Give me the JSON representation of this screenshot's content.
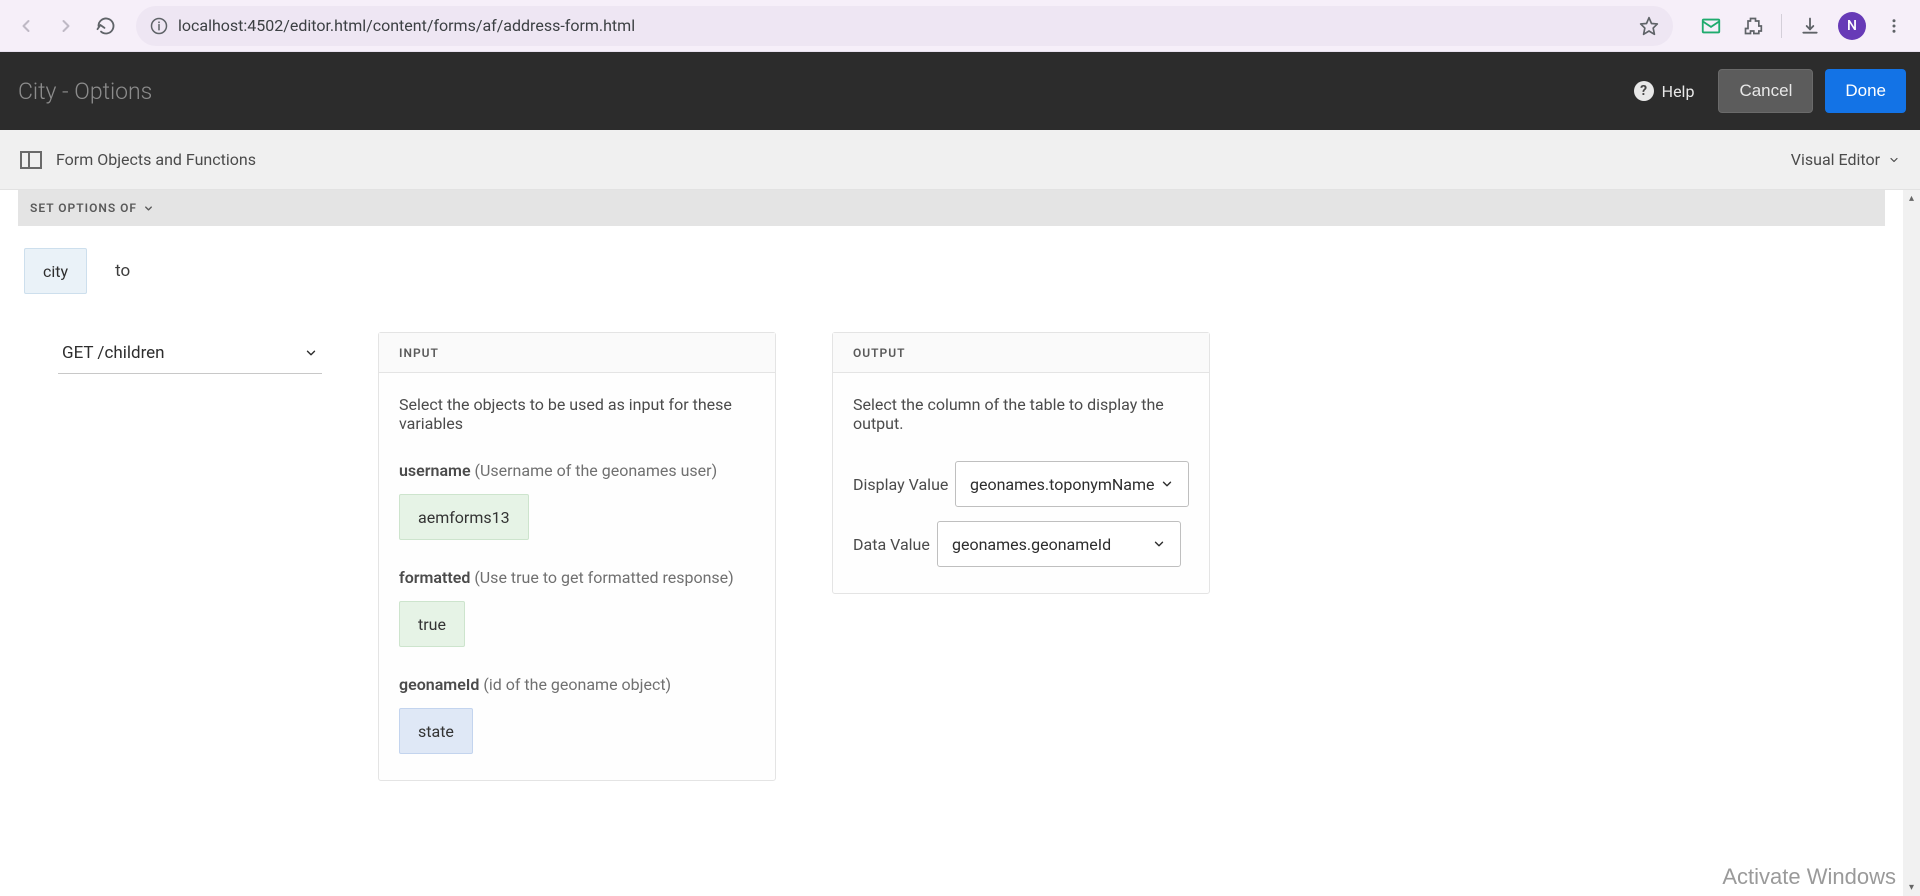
{
  "browser": {
    "url": "localhost:4502/editor.html/content/forms/af/address-form.html",
    "avatar_initial": "N"
  },
  "header": {
    "title": "City - Options",
    "help_label": "Help",
    "cancel_label": "Cancel",
    "done_label": "Done"
  },
  "toolbar": {
    "left_label": "Form Objects and Functions",
    "editor_mode": "Visual Editor"
  },
  "rule": {
    "type_label": "SET OPTIONS OF",
    "target_field": "city",
    "preposition": "to",
    "endpoint": "GET /children"
  },
  "input_panel": {
    "header": "INPUT",
    "instruction": "Select the objects to be used as input for these variables",
    "fields": [
      {
        "name": "username",
        "hint": "(Username of the geonames user)",
        "value": "aemforms13",
        "chip_style": "value"
      },
      {
        "name": "formatted",
        "hint": "(Use true to get formatted response)",
        "value": "true",
        "chip_style": "value"
      },
      {
        "name": "geonameId",
        "hint": "(id of the geoname object)",
        "value": "state",
        "chip_style": "state"
      }
    ]
  },
  "output_panel": {
    "header": "OUTPUT",
    "instruction": "Select the column of the table to display the output.",
    "display_value_label": "Display Value",
    "display_value_selection": "geonames.toponymName",
    "data_value_label": "Data Value",
    "data_value_selection": "geonames.geonameId"
  },
  "watermark": "Activate Windows"
}
